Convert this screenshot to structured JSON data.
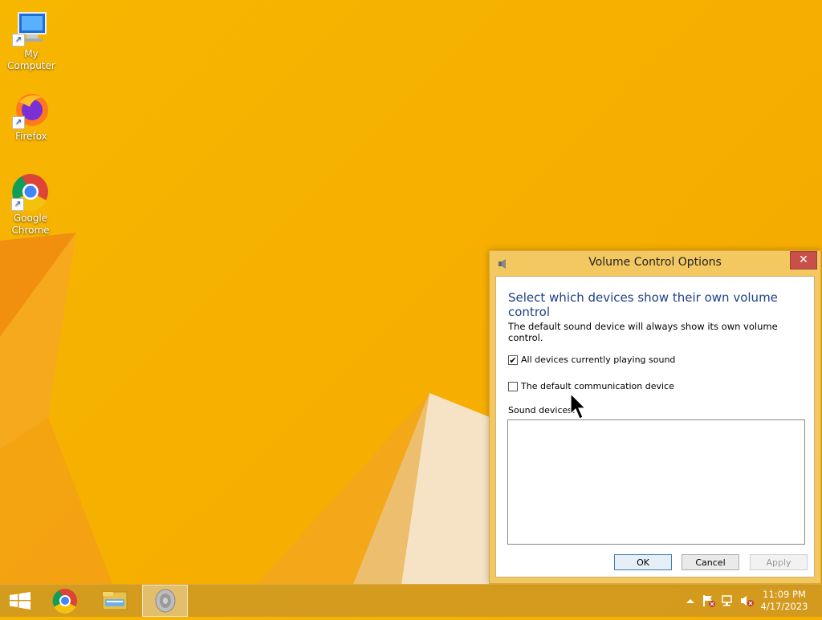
{
  "desktop": {
    "icons": [
      {
        "label": "My Computer",
        "icon": "computer-icon"
      },
      {
        "label": "Firefox",
        "icon": "firefox-icon"
      },
      {
        "label": "Google Chrome",
        "icon": "chrome-icon"
      }
    ]
  },
  "dialog": {
    "title": "Volume Control Options",
    "close_glyph": "✕",
    "heading": "Select which devices show their own volume control",
    "description": "The default sound device will always show its own volume control.",
    "checkbox_all": {
      "label": "All devices currently playing sound",
      "checked": true,
      "glyph": "✔"
    },
    "checkbox_comm": {
      "label": "The default communication device",
      "checked": false
    },
    "sound_devices_label": "Sound devices:",
    "buttons": {
      "ok": "OK",
      "cancel": "Cancel",
      "apply": "Apply"
    }
  },
  "taskbar": {
    "items": [
      "start-icon",
      "chrome-icon",
      "file-explorer-icon",
      "speaker-icon"
    ],
    "time": "11:09 PM",
    "date": "4/17/2023"
  }
}
